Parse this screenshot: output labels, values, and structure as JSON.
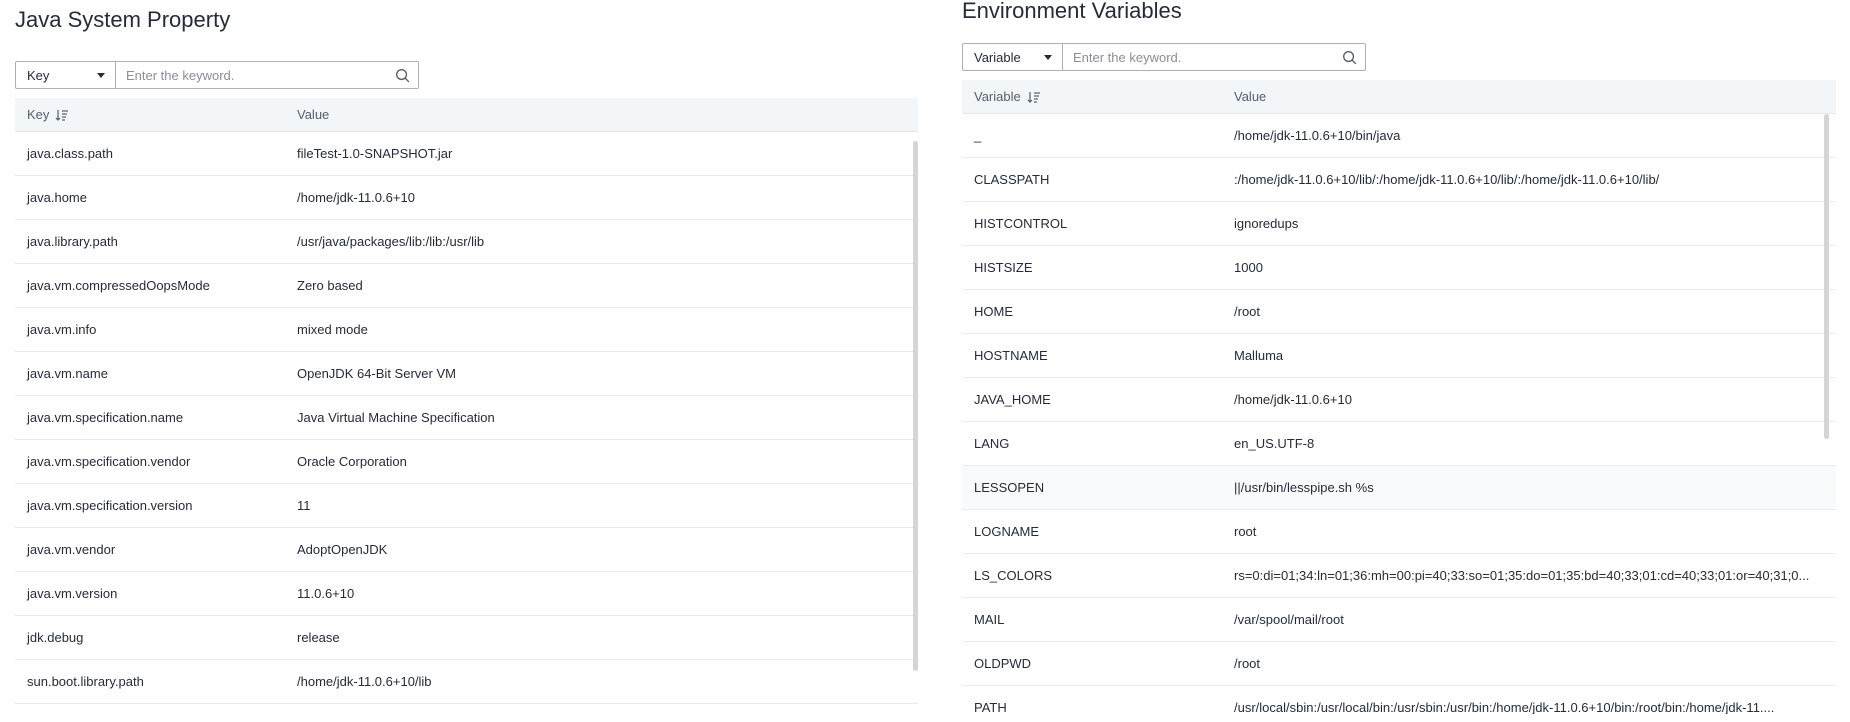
{
  "left": {
    "title": "Java System Property",
    "filter_select": "Key",
    "search_placeholder": "Enter the keyword.",
    "columns": [
      "Key",
      "Value"
    ],
    "rows": [
      {
        "key": "java.class.path",
        "value": "fileTest-1.0-SNAPSHOT.jar"
      },
      {
        "key": "java.home",
        "value": "/home/jdk-11.0.6+10"
      },
      {
        "key": "java.library.path",
        "value": "/usr/java/packages/lib:/lib:/usr/lib"
      },
      {
        "key": "java.vm.compressedOopsMode",
        "value": "Zero based"
      },
      {
        "key": "java.vm.info",
        "value": "mixed mode"
      },
      {
        "key": "java.vm.name",
        "value": "OpenJDK 64-Bit Server VM"
      },
      {
        "key": "java.vm.specification.name",
        "value": "Java Virtual Machine Specification"
      },
      {
        "key": "java.vm.specification.vendor",
        "value": "Oracle Corporation"
      },
      {
        "key": "java.vm.specification.version",
        "value": "11"
      },
      {
        "key": "java.vm.vendor",
        "value": "AdoptOpenJDK"
      },
      {
        "key": "java.vm.version",
        "value": "11.0.6+10"
      },
      {
        "key": "jdk.debug",
        "value": "release"
      },
      {
        "key": "sun.boot.library.path",
        "value": "/home/jdk-11.0.6+10/lib"
      }
    ]
  },
  "right": {
    "title": "Environment Variables",
    "filter_select": "Variable",
    "search_placeholder": "Enter the keyword.",
    "columns": [
      "Variable",
      "Value"
    ],
    "rows": [
      {
        "key": "_",
        "value": "/home/jdk-11.0.6+10/bin/java"
      },
      {
        "key": "CLASSPATH",
        "value": ":/home/jdk-11.0.6+10/lib/:/home/jdk-11.0.6+10/lib/:/home/jdk-11.0.6+10/lib/"
      },
      {
        "key": "HISTCONTROL",
        "value": "ignoredups"
      },
      {
        "key": "HISTSIZE",
        "value": "1000"
      },
      {
        "key": "HOME",
        "value": "/root"
      },
      {
        "key": "HOSTNAME",
        "value": "Malluma"
      },
      {
        "key": "JAVA_HOME",
        "value": "/home/jdk-11.0.6+10"
      },
      {
        "key": "LANG",
        "value": "en_US.UTF-8"
      },
      {
        "key": "LESSOPEN",
        "value": "||/usr/bin/lesspipe.sh %s"
      },
      {
        "key": "LOGNAME",
        "value": "root"
      },
      {
        "key": "LS_COLORS",
        "value": "rs=0:di=01;34:ln=01;36:mh=00:pi=40;33:so=01;35:do=01;35:bd=40;33;01:cd=40;33;01:or=40;31;0..."
      },
      {
        "key": "MAIL",
        "value": "/var/spool/mail/root"
      },
      {
        "key": "OLDPWD",
        "value": "/root"
      },
      {
        "key": "PATH",
        "value": "/usr/local/sbin:/usr/local/bin:/usr/sbin:/usr/bin:/home/jdk-11.0.6+10/bin:/root/bin:/home/jdk-11...."
      }
    ]
  },
  "icons": {
    "search": "search-icon",
    "sort": "sort-icon",
    "dropdown": "chevron-down-icon"
  },
  "colors": {
    "header_bg": "#f3f6f9",
    "row_highlight": "#f9fafc",
    "text": "#252b3a",
    "muted": "#575d6c"
  }
}
